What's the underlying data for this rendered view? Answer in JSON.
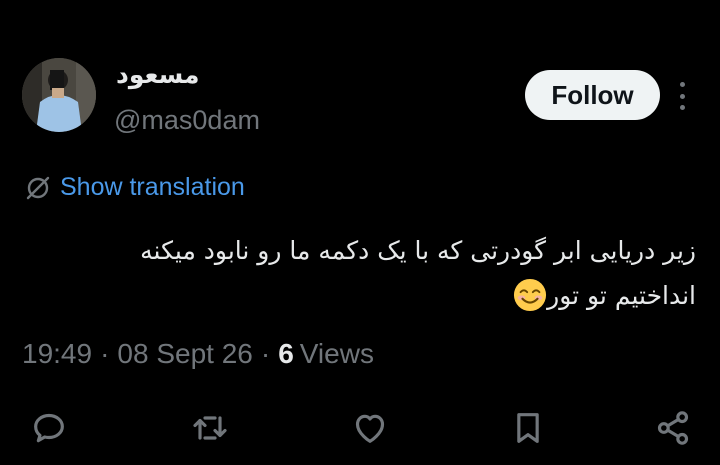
{
  "author": {
    "display_name": "مسعود",
    "handle": "@mas0dam"
  },
  "follow_label": "Follow",
  "translation_label": "Show translation",
  "tweet": {
    "text_line1": "زیر دریایی ابر گودرتی که با یک دکمه ما رو نابود میکنه",
    "text_line2": "انداختیم تو تور",
    "emoji": "smiling-face-emoji"
  },
  "meta": {
    "time": "19:49",
    "separator": "·",
    "date": "08 Sept 26",
    "views_count": "6",
    "views_label": "Views"
  },
  "actions": [
    "reply-icon",
    "repost-icon",
    "like-icon",
    "bookmark-icon",
    "share-icon"
  ],
  "colors": {
    "background": "#000000",
    "text": "#e7e9ea",
    "muted": "#71767b",
    "link": "#4a99e9",
    "follow_bg": "#eff3f4"
  }
}
